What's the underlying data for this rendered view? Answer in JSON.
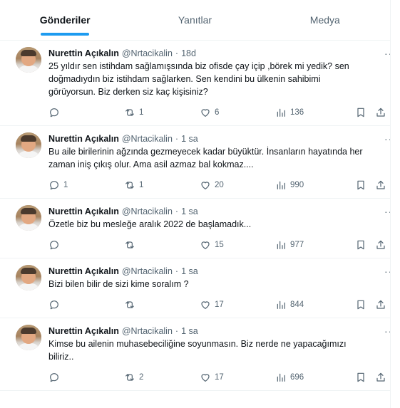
{
  "tabs": [
    {
      "label": "Gönderiler",
      "active": true
    },
    {
      "label": "Yanıtlar",
      "active": false
    },
    {
      "label": "Medya",
      "active": false
    }
  ],
  "colors": {
    "accent": "#1d9bf0",
    "text": "#0f1419",
    "secondary": "#536471",
    "divider": "#eff3f4"
  },
  "tweets": [
    {
      "name": "Nurettin Açıkalın",
      "handle": "@Nrtacikalin",
      "time": "18d",
      "text": "25 yıldır sen istihdam sağlamışsında biz ofisde çay içip ,börek mi yedik? sen doğmadıydın biz istihdam sağlarken. Sen kendini bu ülkenin sahibimi görüyorsun. Biz derken siz kaç kişisiniz?",
      "replies": "",
      "retweets": "1",
      "likes": "6",
      "views": "136"
    },
    {
      "name": "Nurettin Açıkalın",
      "handle": "@Nrtacikalin",
      "time": "1 sa",
      "text": "Bu aile birilerinin ağzında gezmeyecek kadar büyüktür. İnsanların hayatında her zaman iniş çıkış olur. Ama asil azmaz bal kokmaz....",
      "replies": "1",
      "retweets": "1",
      "likes": "20",
      "views": "990"
    },
    {
      "name": "Nurettin Açıkalın",
      "handle": "@Nrtacikalin",
      "time": "1 sa",
      "text": "Özetle biz bu mesleğe aralık 2022 de başlamadık...",
      "replies": "",
      "retweets": "",
      "likes": "15",
      "views": "977"
    },
    {
      "name": "Nurettin Açıkalın",
      "handle": "@Nrtacikalin",
      "time": "1 sa",
      "text": "Bizi bilen bilir de sizi kime soralım ?",
      "replies": "",
      "retweets": "",
      "likes": "17",
      "views": "844"
    },
    {
      "name": "Nurettin Açıkalın",
      "handle": "@Nrtacikalin",
      "time": "1 sa",
      "text": "Kimse bu ailenin muhasebeciliğine soyunmasın. Biz nerde ne yapacağımızı biliriz..",
      "replies": "",
      "retweets": "2",
      "likes": "17",
      "views": "696"
    }
  ],
  "separator": "·",
  "more_glyph": "···",
  "icons": {
    "reply": "reply-icon",
    "retweet": "retweet-icon",
    "like": "heart-icon",
    "views": "views-chart-icon",
    "bookmark": "bookmark-icon",
    "share": "share-icon"
  }
}
